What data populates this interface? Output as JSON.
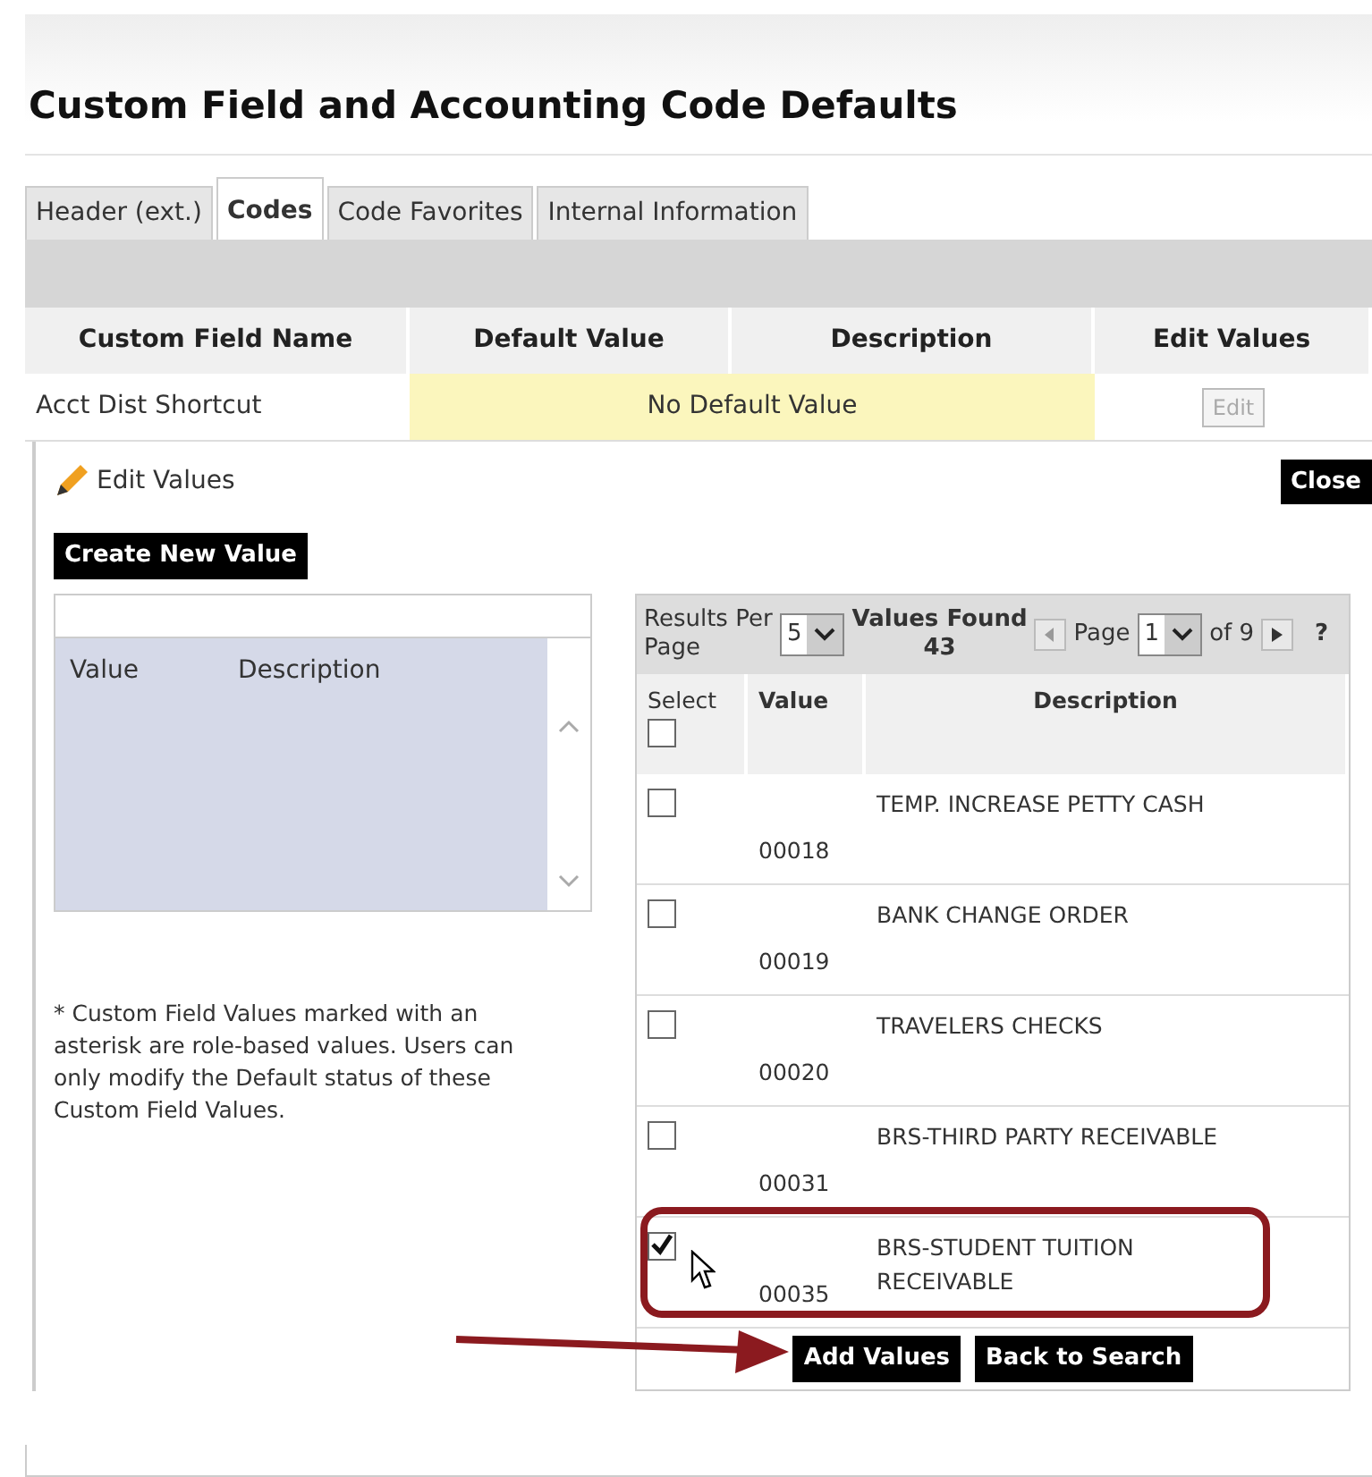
{
  "title": "Custom Field and Accounting Code Defaults",
  "tabs": [
    {
      "label": "Header (ext.)",
      "selected": false
    },
    {
      "label": "Codes",
      "selected": true
    },
    {
      "label": "Code Favorites",
      "selected": false
    },
    {
      "label": "Internal Information",
      "selected": false
    }
  ],
  "fields_table": {
    "columns": [
      "Custom Field Name",
      "Default Value",
      "Description",
      "Edit Values"
    ],
    "rows": [
      {
        "name": "Acct Dist Shortcut",
        "default_value": "No Default Value",
        "edit_button": "Edit",
        "disabled": true
      }
    ]
  },
  "edit_values": {
    "heading": "Edit Values",
    "close_button": "Close",
    "create_button": "Create New Value",
    "list_columns": [
      "Value",
      "Description"
    ],
    "footnote": "* Custom Field Values marked with an asterisk are role-based values. Users can only modify the Default status of these Custom Field Values."
  },
  "results": {
    "per_page_label": "Results Per Page",
    "per_page_value": "5",
    "found_label": "Values Found",
    "found_count": "43",
    "page_label": "Page",
    "page_value": "1",
    "page_total": "of 9",
    "help": "?",
    "columns": [
      "Select",
      "Value",
      "Description"
    ],
    "select_all_checked": false,
    "rows": [
      {
        "checked": false,
        "value": "00018",
        "description": "TEMP. INCREASE PETTY CASH",
        "highlighted": false
      },
      {
        "checked": false,
        "value": "00019",
        "description": "BANK CHANGE ORDER",
        "highlighted": false
      },
      {
        "checked": false,
        "value": "00020",
        "description": "TRAVELERS CHECKS",
        "highlighted": false
      },
      {
        "checked": false,
        "value": "00031",
        "description": "BRS-THIRD PARTY RECEIVABLE",
        "highlighted": false
      },
      {
        "checked": true,
        "value": "00035",
        "description": "BRS-STUDENT TUITION RECEIVABLE",
        "highlighted": true
      }
    ],
    "buttons": [
      {
        "label": "Add Values",
        "pointed": true
      },
      {
        "label": "Back to Search",
        "pointed": false
      }
    ]
  }
}
